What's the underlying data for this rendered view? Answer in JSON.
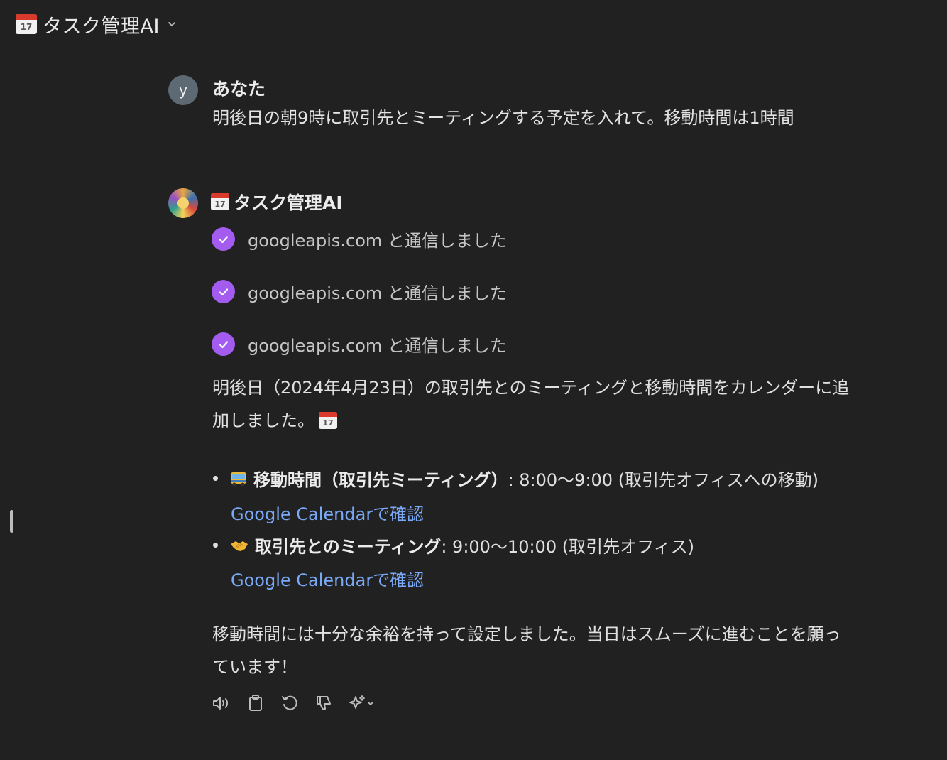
{
  "header": {
    "title": "タスク管理AI",
    "calendar_icon_day": "17"
  },
  "user_message": {
    "avatar_letter": "y",
    "author": "あなた",
    "text": "明後日の朝9時に取引先とミーティングする予定を入れて。移動時間は1時間"
  },
  "assistant": {
    "name": "タスク管理AI",
    "calendar_icon_day": "17",
    "tool_calls": [
      {
        "label": "googleapis.com と通信しました"
      },
      {
        "label": "googleapis.com と通信しました"
      },
      {
        "label": "googleapis.com と通信しました"
      }
    ],
    "intro_line1": "明後日（2024年4月23日）の取引先とのミーティングと移動時間をカレンダーに追",
    "intro_line2": "加しました。",
    "events": [
      {
        "icon": "bus-icon",
        "title": "移動時間（取引先ミーティング）",
        "detail": ": 8:00〜9:00 (取引先オフィスへの移動)",
        "link": "Google Calendarで確認"
      },
      {
        "icon": "handshake-icon",
        "title": "取引先とのミーティング",
        "detail": ": 9:00〜10:00 (取引先オフィス)",
        "link": "Google Calendarで確認"
      }
    ],
    "closing_line1": "移動時間には十分な余裕を持って設定しました。当日はスムーズに進むことを願っ",
    "closing_line2": "ています！"
  },
  "actions": [
    "read-aloud-icon",
    "copy-icon",
    "regenerate-icon",
    "thumbs-down-icon",
    "sparkle-model-icon"
  ],
  "colors": {
    "background": "#212121",
    "check": "#a45cf0",
    "link": "#7aa9f7"
  }
}
